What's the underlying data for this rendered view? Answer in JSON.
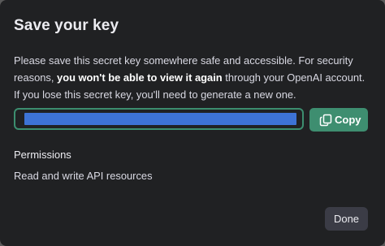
{
  "dialog": {
    "title": "Save your key",
    "message_part1": "Please save this secret key somewhere safe and accessible. For security reasons, ",
    "message_bold": "you won't be able to view it again",
    "message_part2": " through your OpenAI account. If you lose this secret key, you'll need to generate a new one."
  },
  "key_field": {
    "value": "",
    "selection_color": "#3d73d6",
    "border_color": "#3c8e6f"
  },
  "copy_button": {
    "label": "Copy",
    "icon": "copy-icon",
    "color": "#3e8e70"
  },
  "permissions": {
    "heading": "Permissions",
    "value": "Read and write API resources"
  },
  "footer": {
    "done_label": "Done"
  },
  "colors": {
    "modal_background": "#202123",
    "backdrop": "#5a5a5a"
  }
}
